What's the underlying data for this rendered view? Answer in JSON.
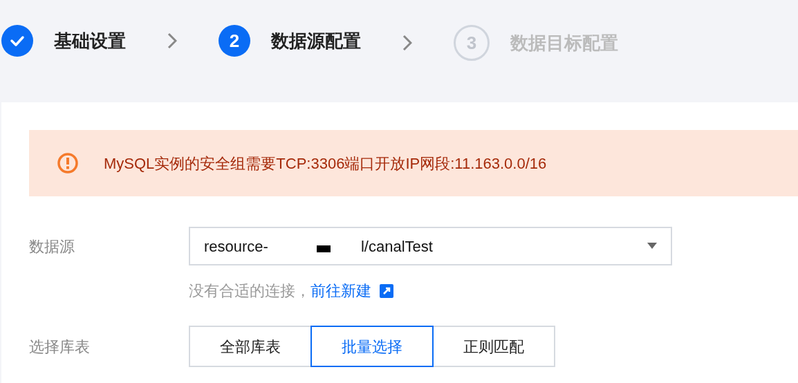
{
  "steps": [
    {
      "label": "基础设置",
      "kind": "done"
    },
    {
      "number": "2",
      "label": "数据源配置",
      "kind": "current"
    },
    {
      "number": "3",
      "label": "数据目标配置",
      "kind": "pending"
    }
  ],
  "alert": {
    "kind": "warning",
    "text": "MySQL实例的安全组需要TCP:3306端口开放IP网段:11.163.0.0/16"
  },
  "form": {
    "source": {
      "label": "数据源",
      "value_start": "resource-",
      "value_end": "l/canalTest",
      "hint": "没有合适的连接，",
      "link": "前往新建"
    },
    "tables": {
      "label": "选择库表",
      "options": [
        {
          "label": "全部库表",
          "selected": false
        },
        {
          "label": "批量选择",
          "selected": true
        },
        {
          "label": "正则匹配",
          "selected": false
        }
      ]
    }
  }
}
